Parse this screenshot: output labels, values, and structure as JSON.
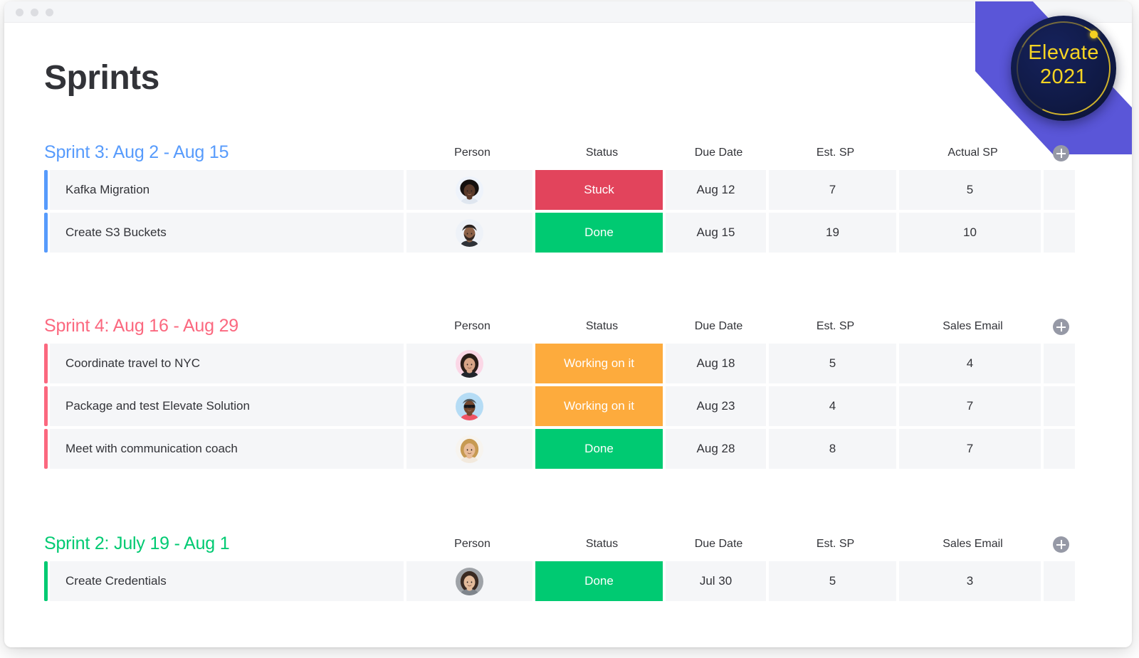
{
  "window": {
    "titlebar_dots": [
      "dot-1",
      "dot-2",
      "dot-3"
    ]
  },
  "branding": {
    "badge_name": "Elevate",
    "badge_year": "2021",
    "badge_bg": "#101a46",
    "badge_text_color": "#f6d423",
    "corner_band_color": "#5a56d8"
  },
  "page_title": "Sprints",
  "colors": {
    "blue": "#579bfc",
    "red": "#e2445c",
    "green": "#00ca72",
    "orange": "#fdab3d",
    "cell_bg": "#f5f6f8",
    "text": "#323338"
  },
  "add_column_label": "+",
  "groups": [
    {
      "title": "Sprint 3: Aug 2 - Aug 15",
      "color": "#579bfc",
      "columns": [
        "Person",
        "Status",
        "Due Date",
        "Est. SP",
        "Actual SP"
      ],
      "rows": [
        {
          "task": "Kafka Migration",
          "person": "avatar-woman-dark-hair",
          "person_bg": "#eef3fb",
          "status": "Stuck",
          "status_color": "#e2445c",
          "due_date": "Aug 12",
          "est_sp": "7",
          "last": "5"
        },
        {
          "task": "Create S3 Buckets",
          "person": "avatar-man-beard",
          "person_bg": "#eef2f8",
          "status": "Done",
          "status_color": "#00ca72",
          "due_date": "Aug 15",
          "est_sp": "19",
          "last": "10"
        }
      ]
    },
    {
      "title": "Sprint 4: Aug 16 - Aug 29",
      "color": "#fb687f",
      "columns": [
        "Person",
        "Status",
        "Due Date",
        "Est. SP",
        "Sales Email"
      ],
      "rows": [
        {
          "task": "Coordinate travel to NYC",
          "person": "avatar-woman-dark-jacket",
          "person_bg": "#fbd7e6",
          "status": "Working on it",
          "status_color": "#fdab3d",
          "due_date": "Aug 18",
          "est_sp": "5",
          "last": "4"
        },
        {
          "task": "Package and test Elevate Solution",
          "person": "avatar-man-sunglasses",
          "person_bg": "#b5dcf5",
          "status": "Working on it",
          "status_color": "#fdab3d",
          "due_date": "Aug 23",
          "est_sp": "4",
          "last": "7"
        },
        {
          "task": "Meet with communication coach",
          "person": "avatar-woman-blonde",
          "person_bg": "#f7f4ef",
          "status": "Done",
          "status_color": "#00ca72",
          "due_date": "Aug 28",
          "est_sp": "8",
          "last": "7"
        }
      ]
    },
    {
      "title": "Sprint 2: July 19 - Aug 1",
      "color": "#00ca72",
      "columns": [
        "Person",
        "Status",
        "Due Date",
        "Est. SP",
        "Sales Email"
      ],
      "rows": [
        {
          "task": "Create Credentials",
          "person": "avatar-woman-smiling",
          "person_bg": "#9fa3a8",
          "status": "Done",
          "status_color": "#00ca72",
          "due_date": "Jul 30",
          "est_sp": "5",
          "last": "3"
        }
      ]
    }
  ]
}
